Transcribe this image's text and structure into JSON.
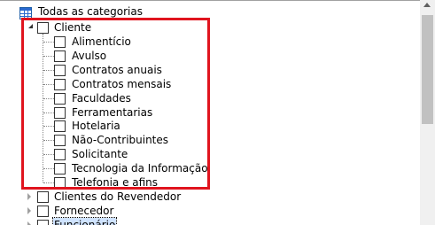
{
  "tree": {
    "root": {
      "label": "Todas as categorias",
      "icon": "category-table-icon"
    },
    "expanded_group": {
      "label": "Cliente",
      "children": [
        "Alimentício",
        "Avulso",
        "Contratos anuais",
        "Contratos mensais",
        "Faculdades",
        "Ferramentarias",
        "Hotelaria",
        "Não-Contribuintes",
        "Solicitante",
        "Tecnologia da Informação",
        "Telefonia e afins"
      ]
    },
    "collapsed_groups": [
      {
        "label": "Clientes do Revendedor"
      },
      {
        "label": "Fornecedor"
      },
      {
        "label": "Funcionário"
      }
    ]
  },
  "colors": {
    "highlight_border": "#e0141e",
    "root_icon": "#2a6ad0"
  }
}
